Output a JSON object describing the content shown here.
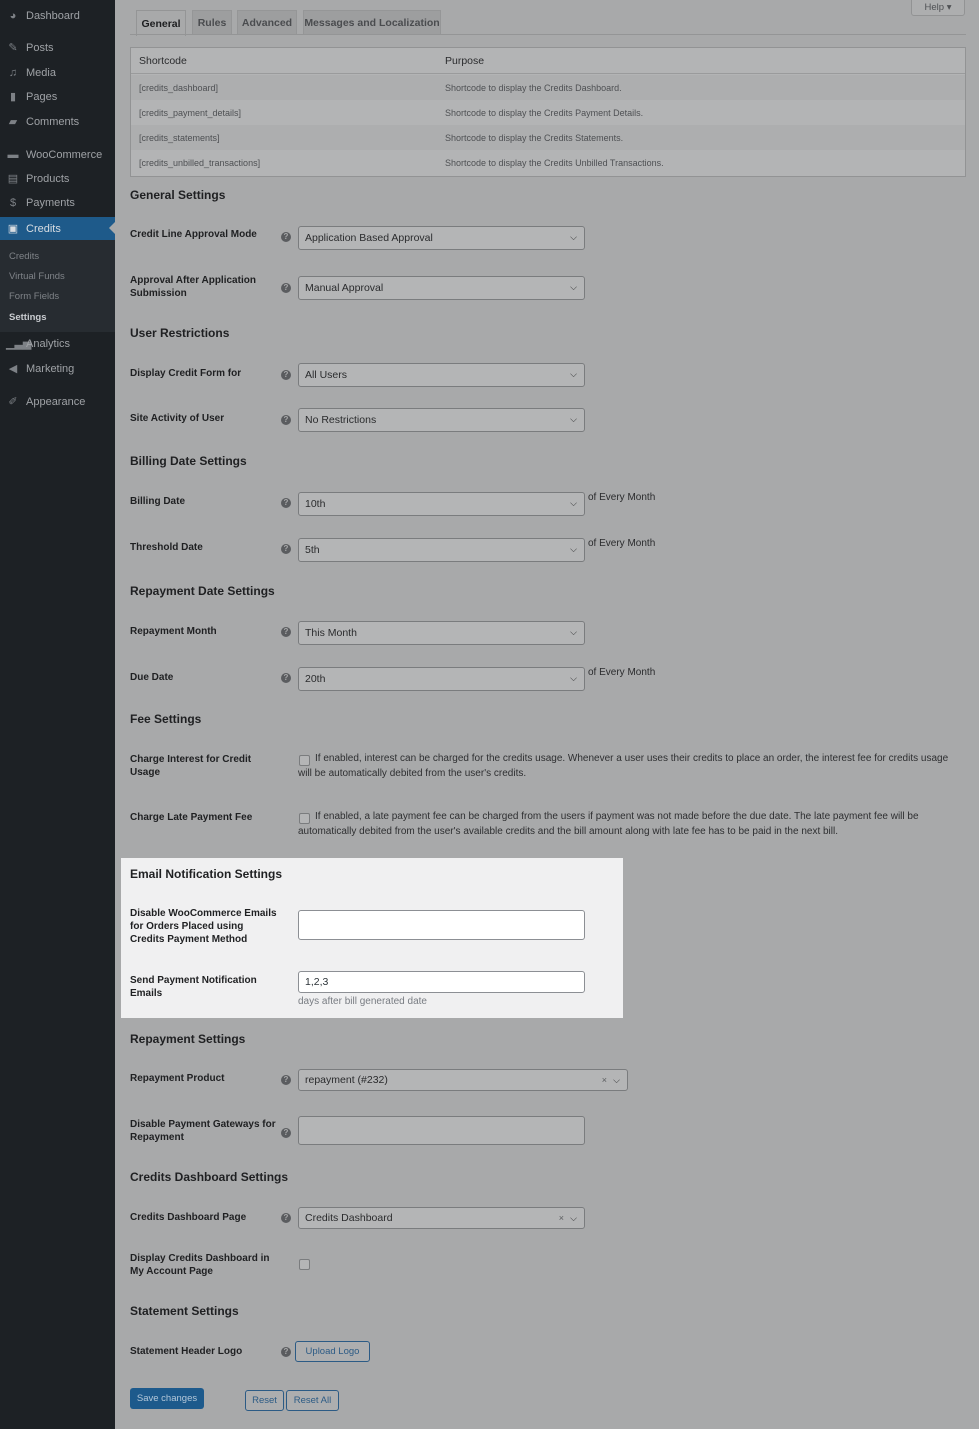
{
  "sidebar": {
    "items": [
      {
        "label": "Dashboard",
        "icon": "dashboard-icon"
      },
      {
        "label": "Posts",
        "icon": "pin-icon"
      },
      {
        "label": "Media",
        "icon": "media-icon"
      },
      {
        "label": "Pages",
        "icon": "pages-icon"
      },
      {
        "label": "Comments",
        "icon": "comment-icon"
      },
      {
        "label": "WooCommerce",
        "icon": "woo-icon"
      },
      {
        "label": "Products",
        "icon": "archive-icon"
      },
      {
        "label": "Payments",
        "icon": "dollar-icon"
      },
      {
        "label": "Credits",
        "icon": "wallet-icon"
      },
      {
        "label": "Analytics",
        "icon": "bar-chart-icon"
      },
      {
        "label": "Marketing",
        "icon": "megaphone-icon"
      },
      {
        "label": "Appearance",
        "icon": "brush-icon"
      }
    ],
    "submenu": [
      "Credits",
      "Virtual Funds",
      "Form Fields",
      "Settings"
    ]
  },
  "help": "Help",
  "tabs": [
    "General",
    "Rules",
    "Advanced",
    "Messages and Localization"
  ],
  "table": {
    "headers": [
      "Shortcode",
      "Purpose"
    ],
    "rows": [
      [
        "[credits_dashboard]",
        "Shortcode to display the Credits Dashboard."
      ],
      [
        "[credits_payment_details]",
        "Shortcode to display the Credits Payment Details."
      ],
      [
        "[credits_statements]",
        "Shortcode to display the Credits Statements."
      ],
      [
        "[credits_unbilled_transactions]",
        "Shortcode to display the Credits Unbilled Transactions."
      ]
    ]
  },
  "headings": {
    "general": "General Settings",
    "user": "User Restrictions",
    "billing": "Billing Date Settings",
    "repaydate": "Repayment Date Settings",
    "fee": "Fee Settings",
    "email": "Email Notification Settings",
    "repay": "Repayment Settings",
    "dashboard": "Credits Dashboard Settings",
    "statement": "Statement Settings"
  },
  "fields": {
    "approval_mode": {
      "label": "Credit Line Approval Mode",
      "value": "Application Based Approval"
    },
    "approval_after": {
      "label": "Approval After Application Submission",
      "value": "Manual Approval"
    },
    "display_form": {
      "label": "Display Credit Form for",
      "value": "All Users"
    },
    "site_activity": {
      "label": "Site Activity of User",
      "value": "No Restrictions"
    },
    "billing_date": {
      "label": "Billing Date",
      "value": "10th",
      "suffix": "of Every Month"
    },
    "threshold_date": {
      "label": "Threshold Date",
      "value": "5th",
      "suffix": "of Every Month"
    },
    "repayment_month": {
      "label": "Repayment Month",
      "value": "This Month"
    },
    "due_date": {
      "label": "Due Date",
      "value": "20th",
      "suffix": "of Every Month"
    },
    "interest": {
      "label": "Charge Interest for Credit Usage",
      "desc": "If enabled, interest can be charged for the credits usage. Whenever a user uses their credits to place an order, the interest fee for credits usage will be automatically debited from the user's credits."
    },
    "late_fee": {
      "label": "Charge Late Payment Fee",
      "desc": "If enabled, a late payment fee can be charged from the users if payment was not made before the due date. The late payment fee will be automatically debited from the user's available credits and the bill amount along with late fee has to be paid in the next bill."
    },
    "disable_woo_emails": {
      "label": "Disable WooCommerce Emails for Orders Placed using Credits Payment Method",
      "value": ""
    },
    "payment_notification": {
      "label": "Send Payment Notification Emails",
      "value": "1,2,3",
      "hint": "days after bill generated date"
    },
    "repayment_product": {
      "label": "Repayment Product",
      "value": "repayment (#232)"
    },
    "disable_gateways": {
      "label": "Disable Payment Gateways for Repayment",
      "value": ""
    },
    "dashboard_page": {
      "label": "Credits Dashboard Page",
      "value": "Credits Dashboard"
    },
    "dashboard_myaccount": {
      "label": "Display Credits Dashboard in My Account Page"
    },
    "header_logo": {
      "label": "Statement Header Logo",
      "button": "Upload Logo"
    }
  },
  "actions": {
    "save": "Save changes",
    "reset": "Reset",
    "reset_all": "Reset All"
  }
}
